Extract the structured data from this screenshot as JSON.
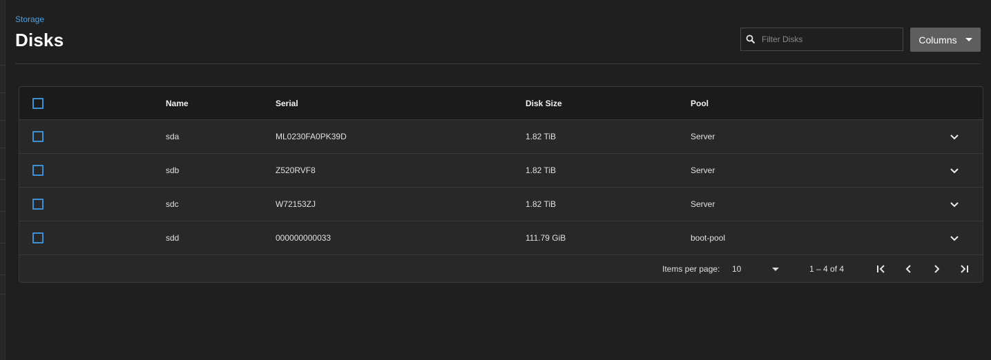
{
  "breadcrumb": {
    "label": "Storage"
  },
  "page": {
    "title": "Disks"
  },
  "filter": {
    "placeholder": "Filter Disks",
    "value": ""
  },
  "columns_button": {
    "label": "Columns"
  },
  "table": {
    "headers": {
      "name": "Name",
      "serial": "Serial",
      "size": "Disk Size",
      "pool": "Pool"
    },
    "rows": [
      {
        "name": "sda",
        "serial": "ML0230FA0PK39D",
        "size": "1.82 TiB",
        "pool": "Server"
      },
      {
        "name": "sdb",
        "serial": "Z520RVF8",
        "size": "1.82 TiB",
        "pool": "Server"
      },
      {
        "name": "sdc",
        "serial": "W72153ZJ",
        "size": "1.82 TiB",
        "pool": "Server"
      },
      {
        "name": "sdd",
        "serial": "000000000033",
        "size": "111.79 GiB",
        "pool": "boot-pool"
      }
    ]
  },
  "paginator": {
    "items_per_page_label": "Items per page:",
    "items_per_page_value": "10",
    "range": "1 – 4 of 4"
  },
  "icons": {
    "search": "search-icon",
    "dropdown": "chevron-down-icon",
    "expand": "chevron-down-icon",
    "first": "first-page-icon",
    "prev": "chevron-left-icon",
    "next": "chevron-right-icon",
    "last": "last-page-icon"
  },
  "colors": {
    "background": "#1f1f1f",
    "card": "#282828",
    "header_row": "#1b1b1b",
    "accent": "#3d8fd6",
    "link": "#4aa3e8",
    "button": "#5e5e5e"
  }
}
